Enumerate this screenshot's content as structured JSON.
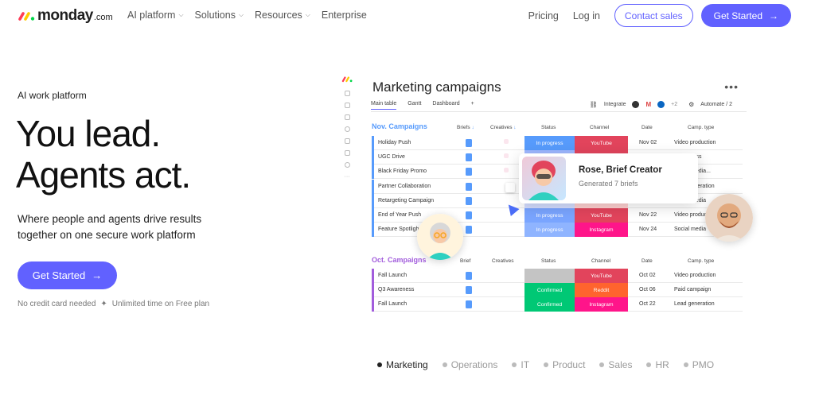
{
  "nav": {
    "logo_text": "monday",
    "logo_suffix": ".com",
    "links": [
      {
        "label": "AI platform",
        "dropdown": true
      },
      {
        "label": "Solutions",
        "dropdown": true
      },
      {
        "label": "Resources",
        "dropdown": true
      },
      {
        "label": "Enterprise",
        "dropdown": false
      }
    ],
    "pricing": "Pricing",
    "login": "Log in",
    "contact": "Contact sales",
    "get_started": "Get Started",
    "arrow": "→"
  },
  "hero": {
    "eyebrow": "AI work platform",
    "headline_1": "You lead.",
    "headline_2": "Agents act.",
    "subtitle": "Where people and agents drive results together on one secure work platform",
    "cta": "Get Started",
    "cta_arrow": "→",
    "fine_1": "No credit card needed",
    "fine_sep": "✦",
    "fine_2": "Unlimited time on Free plan"
  },
  "board": {
    "title": "Marketing campaigns",
    "more": "•••",
    "tabs": [
      "Main table",
      "Gantt",
      "Dashboard",
      "+"
    ],
    "integrate": "Integrate",
    "integrate_count": "+2",
    "automate": "Automate / 2",
    "groups": [
      {
        "title": "Nov. Campaigns",
        "color": "#579bfc",
        "headers": [
          "Briefs",
          "Creatives",
          "Status",
          "Channel",
          "Date",
          "Camp. type"
        ],
        "rows": [
          {
            "name": "Holiday Push",
            "status": "In progress",
            "status_color": "#579bfc",
            "channel": "YouTube",
            "channel_color": "#e2445c",
            "date": "Nov 02",
            "type": "Video production"
          },
          {
            "name": "UGC Drive",
            "status": "",
            "status_color": "#9fb8ff",
            "channel": "",
            "channel_color": "#e2445c",
            "date": "",
            "type": "Awareness"
          },
          {
            "name": "Black Friday Promo",
            "status": "",
            "status_color": "#b3c8ff",
            "channel": "",
            "channel_color": "#ff7575",
            "date": "",
            "type": "Social media..."
          },
          {
            "name": "Partner Collaboration",
            "status": "",
            "status_color": "#c6d3ff",
            "channel": "",
            "channel_color": "#ffadad",
            "date": "",
            "type": "Lead generation"
          },
          {
            "name": "Retargeting Campaign",
            "status": "",
            "status_color": "#d4ddff",
            "channel": "",
            "channel_color": "#ffd0d0",
            "date": "",
            "type": "Social media"
          },
          {
            "name": "End of Year Push",
            "status": "In progress",
            "status_color": "#7aa5ff",
            "channel": "YouTube",
            "channel_color": "#e2445c",
            "date": "Nov 22",
            "type": "Video production"
          },
          {
            "name": "Feature Spotlight",
            "status": "In progress",
            "status_color": "#8fb4ff",
            "channel": "Instagram",
            "channel_color": "#ff158a",
            "date": "Nov 24",
            "type": "Social media"
          }
        ]
      },
      {
        "title": "Oct. Campaigns",
        "color": "#a25ddc",
        "headers": [
          "Brief",
          "Creatives",
          "Status",
          "Channel",
          "Date",
          "Camp. type"
        ],
        "rows": [
          {
            "name": "Fall Launch",
            "status": "",
            "status_color": "#c4c4c4",
            "channel": "YouTube",
            "channel_color": "#e2445c",
            "date": "Oct 02",
            "type": "Video production"
          },
          {
            "name": "Q3 Awareness",
            "status": "Confirmed",
            "status_color": "#00c875",
            "channel": "Reddit",
            "channel_color": "#ff642e",
            "date": "Oct 06",
            "type": "Paid campaign"
          },
          {
            "name": "Fall Launch",
            "status": "Confirmed",
            "status_color": "#00c875",
            "channel": "Instagram",
            "channel_color": "#ff158a",
            "date": "Oct 22",
            "type": "Lead generation"
          }
        ]
      }
    ]
  },
  "agent_popup": {
    "name": "Rose, Brief Creator",
    "status": "Generated 7 briefs"
  },
  "categories": [
    {
      "label": "Marketing",
      "active": true
    },
    {
      "label": "Operations",
      "active": false
    },
    {
      "label": "IT",
      "active": false
    },
    {
      "label": "Product",
      "active": false
    },
    {
      "label": "Sales",
      "active": false
    },
    {
      "label": "HR",
      "active": false
    },
    {
      "label": "PMO",
      "active": false
    }
  ],
  "colors": {
    "brand": "#6161ff",
    "logo_red": "#ff3d57",
    "logo_yellow": "#ffcb00",
    "logo_green": "#00d647"
  }
}
